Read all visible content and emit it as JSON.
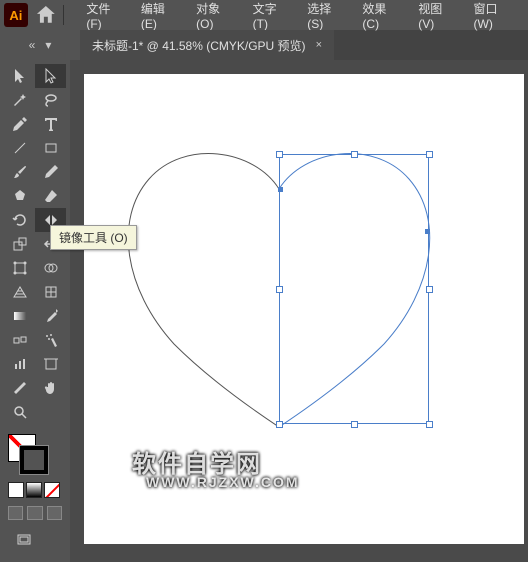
{
  "app": {
    "logo": "Ai"
  },
  "menu": [
    "文件(F)",
    "编辑(E)",
    "对象(O)",
    "文字(T)",
    "选择(S)",
    "效果(C)",
    "视图(V)",
    "窗口(W)"
  ],
  "tab": {
    "title": "未标题-1* @ 41.58%  (CMYK/GPU 预览)",
    "close": "×"
  },
  "tooltip": "镜像工具 (O)",
  "watermark": {
    "line1": "软件自学网",
    "line2": "WWW.RJZXW.COM"
  },
  "tools": [
    [
      "selection",
      "direct-selection"
    ],
    [
      "magic-wand",
      "lasso"
    ],
    [
      "pen",
      "type"
    ],
    [
      "line",
      "rectangle"
    ],
    [
      "brush",
      "pencil"
    ],
    [
      "shaper",
      "eraser"
    ],
    [
      "rotate",
      "reflect"
    ],
    [
      "scale3",
      "width"
    ],
    [
      "free-transform",
      "shape-builder"
    ],
    [
      "perspective",
      "mesh"
    ],
    [
      "gradient",
      "eyedropper"
    ],
    [
      "blend",
      "symbol-sprayer"
    ],
    [
      "column-graph",
      "artboard"
    ],
    [
      "slice",
      "hand"
    ],
    [
      "zoom",
      "empty"
    ]
  ],
  "chart_data": null
}
